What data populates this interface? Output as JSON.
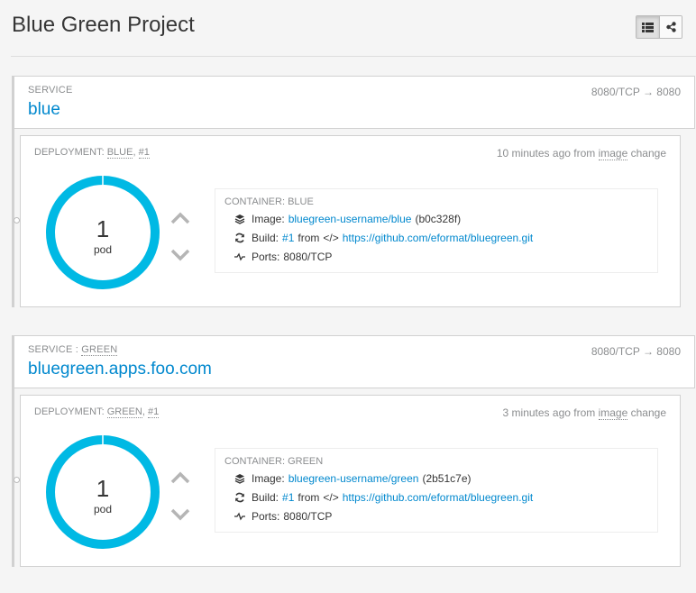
{
  "page": {
    "title": "Blue Green Project"
  },
  "colors": {
    "accent": "#0088ce",
    "donut": "#00b9e4"
  },
  "services": [
    {
      "label": "SERVICE",
      "name": "blue",
      "ports": "8080/TCP → 8080",
      "deployment": {
        "prefix": "DEPLOYMENT:",
        "name": "BLUE",
        "sep": ",",
        "num": "#1",
        "time_prefix": "10 minutes ago from",
        "time_trigger": "image",
        "time_suffix": "change",
        "pods": "1",
        "pods_label": "pod",
        "pods_ready_fraction": 1.0,
        "container": {
          "label": "CONTAINER: BLUE",
          "image_label": "Image:",
          "image_link": "bluegreen-username/blue",
          "image_id": "(b0c328f)",
          "build_label": "Build:",
          "build_link": "#1",
          "build_from": "from",
          "source_icon": "</>",
          "build_source": "https://github.com/eformat/bluegreen.git",
          "ports_label": "Ports:",
          "ports_value": "8080/TCP"
        }
      }
    },
    {
      "label_prefix": "SERVICE :",
      "label_name": "GREEN",
      "name": "bluegreen.apps.foo.com",
      "ports": "8080/TCP → 8080",
      "deployment": {
        "prefix": "DEPLOYMENT:",
        "name": "GREEN",
        "sep": ",",
        "num": "#1",
        "time_prefix": "3 minutes ago from",
        "time_trigger": "image",
        "time_suffix": "change",
        "pods": "1",
        "pods_label": "pod",
        "pods_ready_fraction": 1.0,
        "container": {
          "label": "CONTAINER: GREEN",
          "image_label": "Image:",
          "image_link": "bluegreen-username/green",
          "image_id": "(2b51c7e)",
          "build_label": "Build:",
          "build_link": "#1",
          "build_from": "from",
          "source_icon": "</>",
          "build_source": "https://github.com/eformat/bluegreen.git",
          "ports_label": "Ports:",
          "ports_value": "8080/TCP"
        }
      }
    }
  ]
}
